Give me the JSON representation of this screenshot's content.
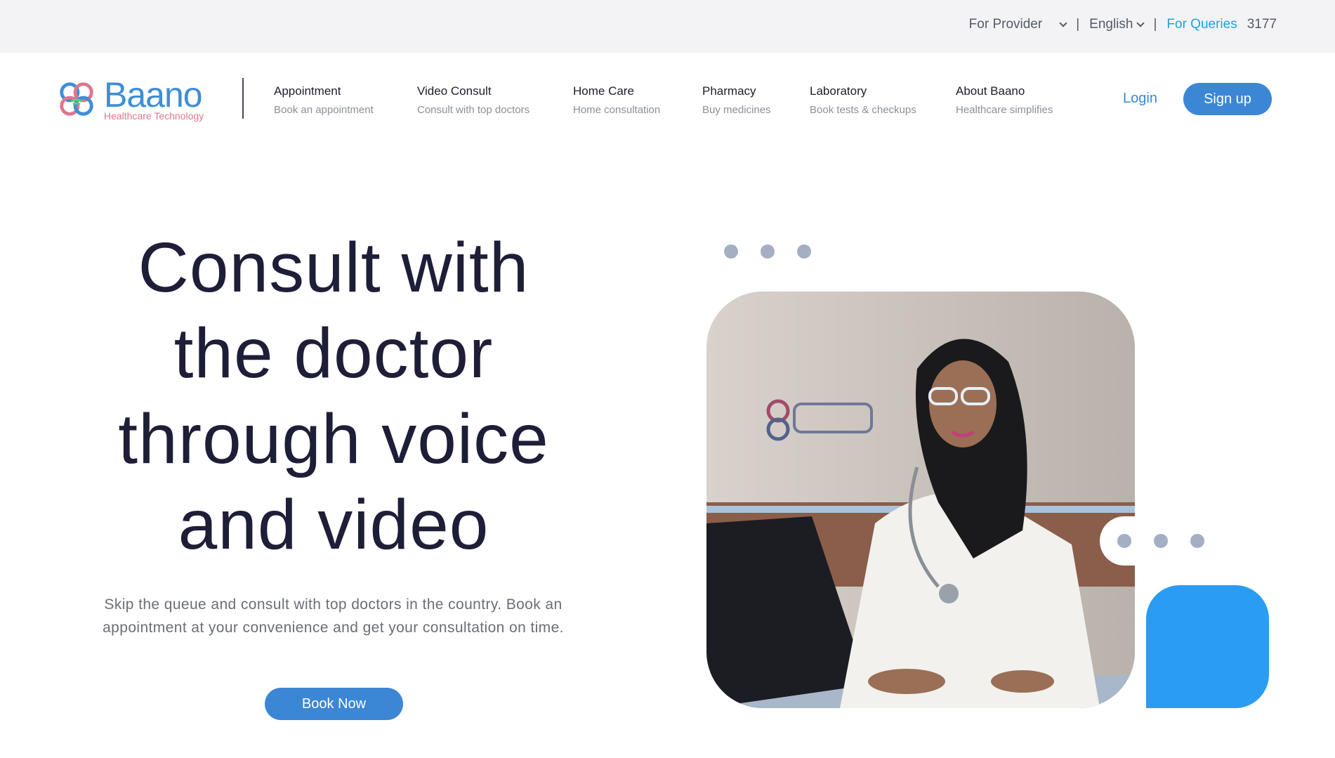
{
  "topbar": {
    "provider_label": "For Provider",
    "language_label": "English",
    "separator": "|",
    "queries_label": "For Queries",
    "phone": "3177"
  },
  "logo": {
    "name": "Baano",
    "tagline": "Healthcare Technology"
  },
  "nav": {
    "items": [
      {
        "title": "Appointment",
        "subtitle": "Book an appointment"
      },
      {
        "title": "Video Consult",
        "subtitle": "Consult with top doctors"
      },
      {
        "title": "Home Care",
        "subtitle": "Home consultation"
      },
      {
        "title": "Pharmacy",
        "subtitle": "Buy medicines"
      },
      {
        "title": "Laboratory",
        "subtitle": "Book tests & checkups"
      },
      {
        "title": "About Baano",
        "subtitle": "Healthcare simplifies"
      }
    ],
    "login_label": "Login",
    "signup_label": "Sign up"
  },
  "hero": {
    "title_lines": [
      "Consult with",
      "the doctor",
      "through voice",
      "and video"
    ],
    "subtitle": "Skip the queue and consult with top doctors in the country. Book an appointment at your convenience and get your consultation on time.",
    "cta_label": "Book Now"
  },
  "colors": {
    "brand_blue": "#3c86d6",
    "accent_blue": "#2b9cf3",
    "link_cyan": "#1ea1e8",
    "logo_pink": "#e0768c",
    "heading": "#1e1e38",
    "topbar_bg": "#f3f3f5"
  },
  "icons": {
    "dropdown": "chevron-down-icon",
    "logo_mark": "baano-logo-icon",
    "typing": "typing-dots-icon"
  }
}
